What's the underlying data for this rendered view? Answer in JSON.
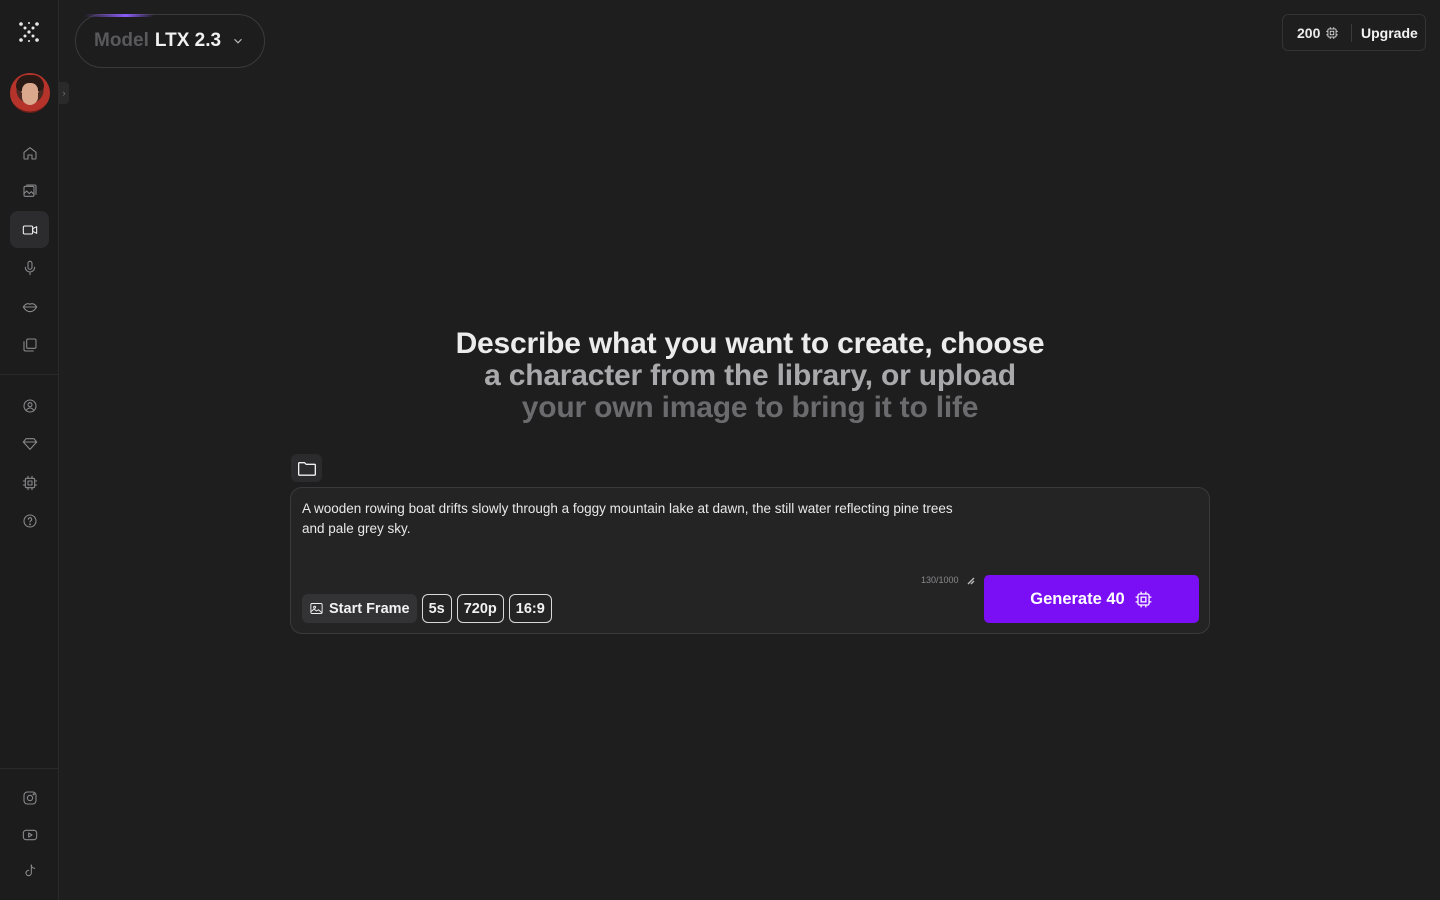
{
  "top": {
    "model_label": "Model",
    "model_value": "LTX 2.3",
    "credits": "200",
    "upgrade_label": "Upgrade"
  },
  "sidebar": {
    "items": [
      {
        "name": "home",
        "icon": "home-icon",
        "active": false
      },
      {
        "name": "images",
        "icon": "image-gallery-icon",
        "active": false
      },
      {
        "name": "video",
        "icon": "video-camera-icon",
        "active": true
      },
      {
        "name": "audio",
        "icon": "microphone-icon",
        "active": false
      },
      {
        "name": "lipsync",
        "icon": "lips-icon",
        "active": false
      },
      {
        "name": "library",
        "icon": "stack-icon",
        "active": false
      },
      {
        "name": "account",
        "icon": "user-circle-icon",
        "active": false
      },
      {
        "name": "pricing",
        "icon": "diamond-icon",
        "active": false
      },
      {
        "name": "credits",
        "icon": "chip-icon",
        "active": false
      },
      {
        "name": "help",
        "icon": "help-icon",
        "active": false
      }
    ],
    "social": [
      "instagram-icon",
      "youtube-icon",
      "tiktok-icon"
    ]
  },
  "heading": {
    "line1": "Describe what you want to create, choose",
    "line2": "a character from the library, or upload",
    "line3": "your own image to bring it to life"
  },
  "prompt": {
    "text": "A wooden rowing boat drifts slowly through a foggy mountain lake at dawn, the still water reflecting pine trees and pale grey sky.",
    "counter": "130/1000"
  },
  "options": {
    "start_frame_label": "Start Frame",
    "duration": "5s",
    "resolution": "720p",
    "aspect": "16:9"
  },
  "generate": {
    "label": "Generate 40"
  },
  "colors": {
    "accent": "#7a0ff5",
    "background": "#1e1e1f"
  }
}
